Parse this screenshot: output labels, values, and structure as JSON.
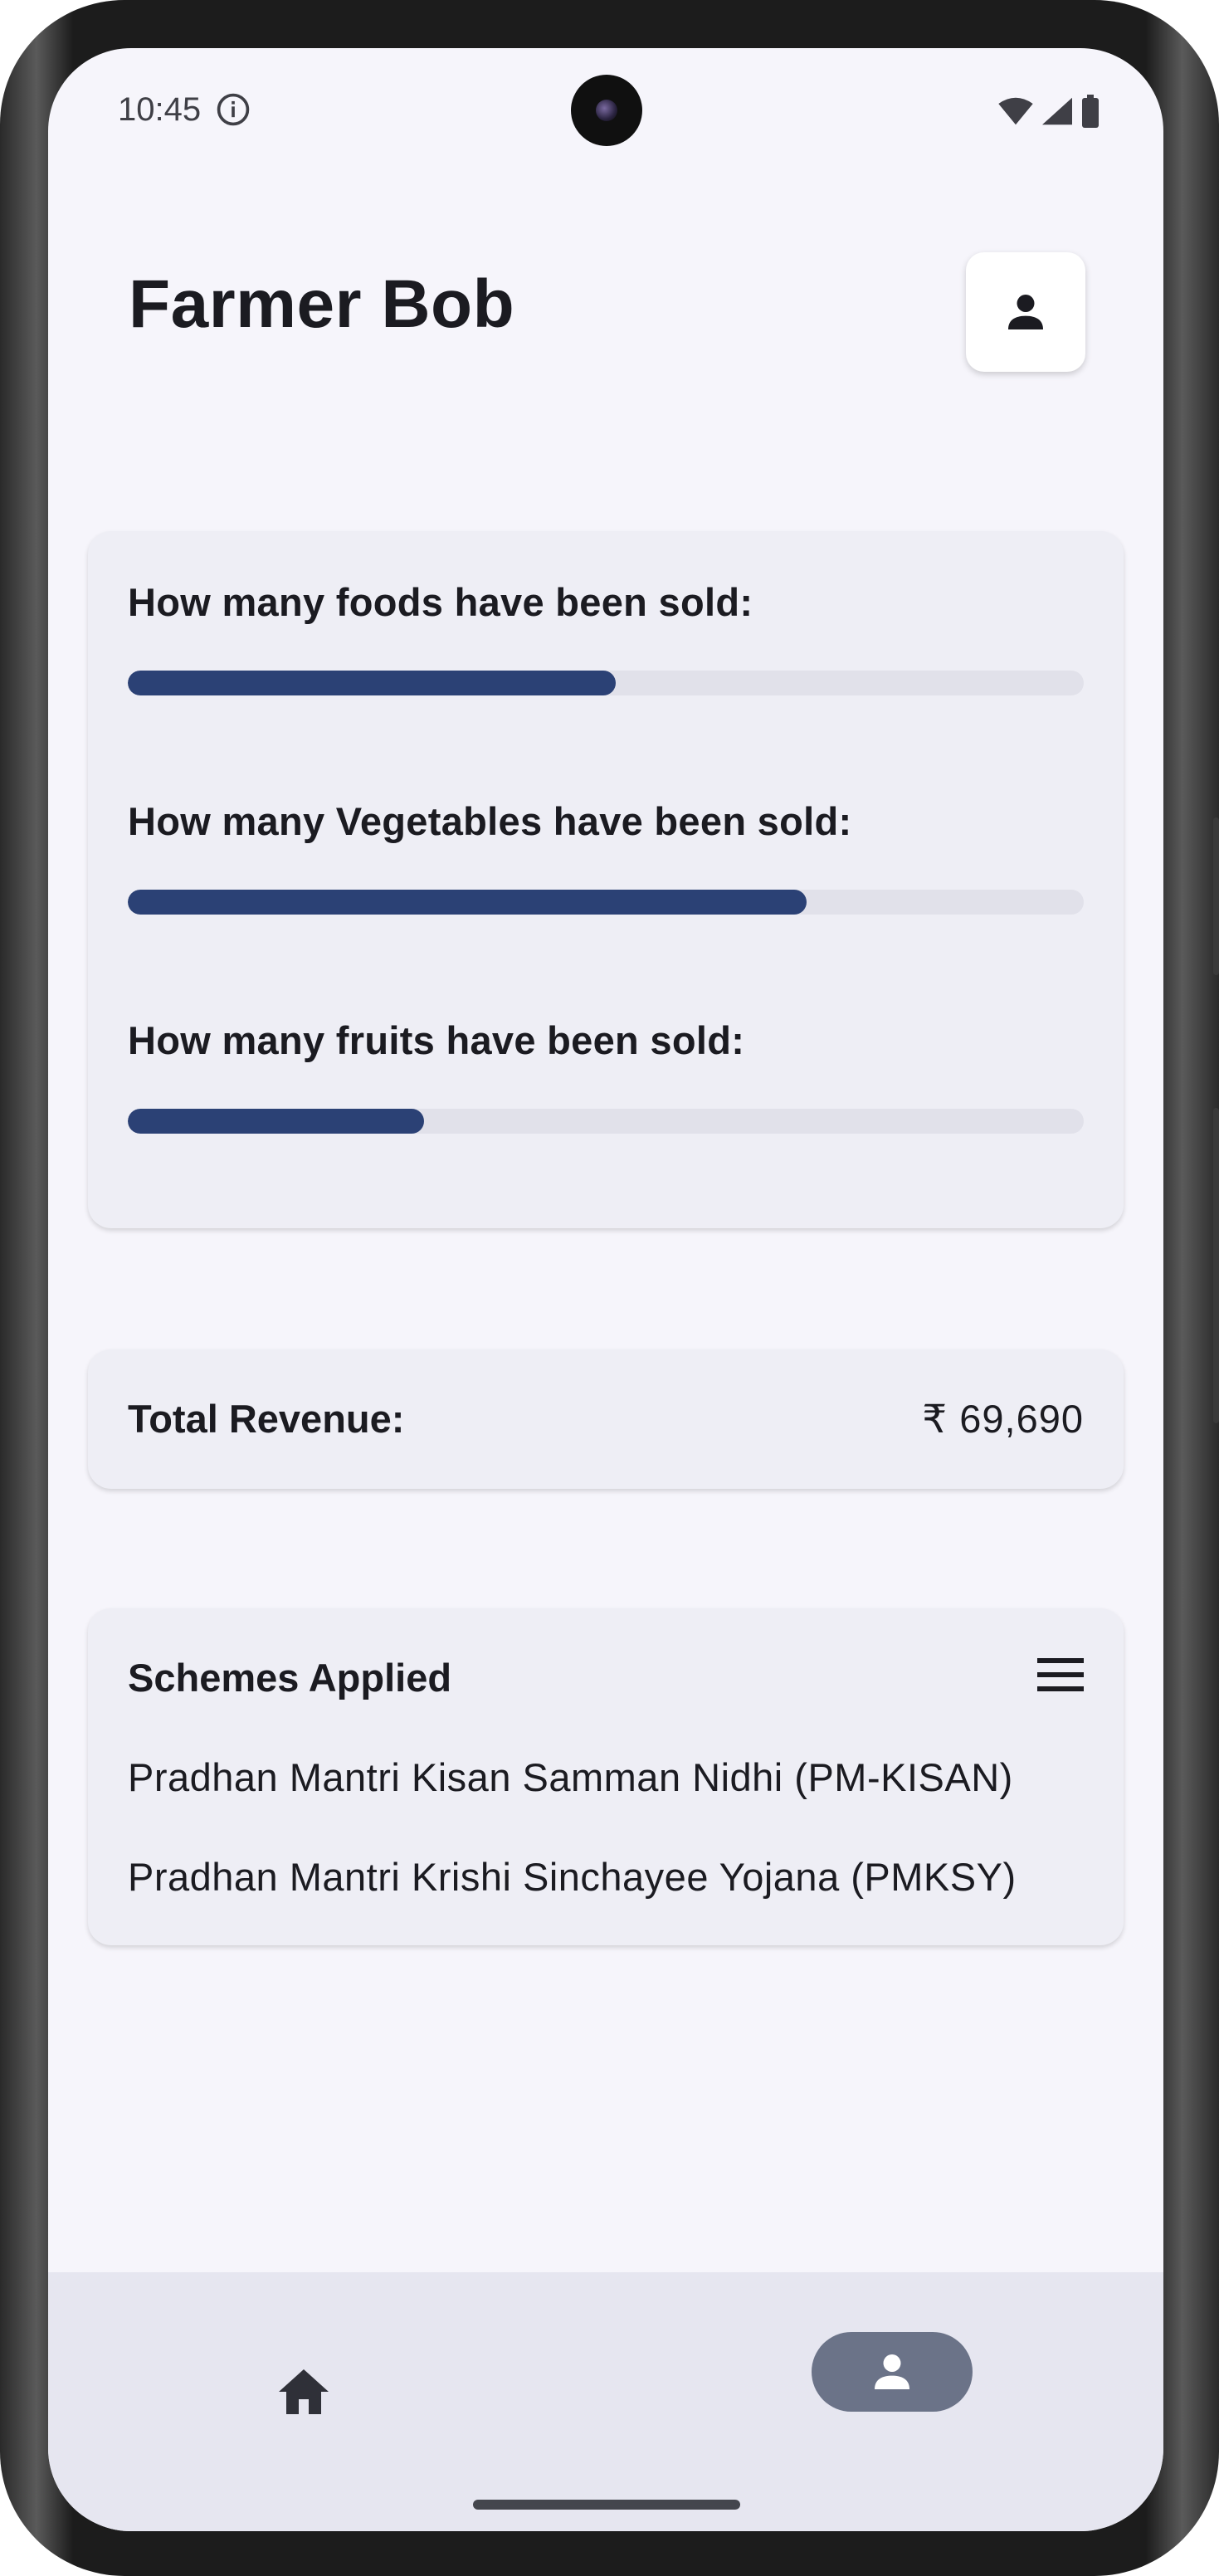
{
  "status_bar": {
    "time": "10:45",
    "icons": [
      "info-icon",
      "wifi-icon",
      "cell-signal-icon",
      "battery-icon"
    ]
  },
  "header": {
    "title": "Farmer Bob",
    "profile_icon": "person-icon"
  },
  "progress": [
    {
      "label": "How many foods have been sold:",
      "percent": 51
    },
    {
      "label": "How many Vegetables have been sold:",
      "percent": 71
    },
    {
      "label": "How many fruits have been sold:",
      "percent": 31
    }
  ],
  "revenue": {
    "label": "Total Revenue:",
    "value": "₹ 69,690"
  },
  "schemes": {
    "title": "Schemes Applied",
    "menu_icon": "menu-icon",
    "items": [
      "Pradhan Mantri Kisan Samman Nidhi (PM-KISAN)",
      "Pradhan Mantri Krishi Sinchayee Yojana (PMKSY)"
    ]
  },
  "bottom_nav": {
    "items": [
      {
        "icon": "home-icon",
        "selected": false
      },
      {
        "icon": "person-icon",
        "selected": true
      }
    ]
  },
  "colors": {
    "progress_fill": "#2b4175",
    "progress_track": "#e1e1ea",
    "card_bg": "#eeeef5",
    "screen_bg": "#f6f5fb",
    "nav_bg": "#e6e6f0",
    "nav_selected_pill": "#6b7388"
  }
}
